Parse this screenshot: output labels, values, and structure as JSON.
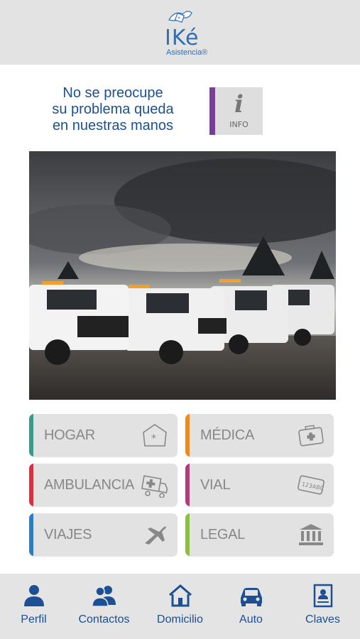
{
  "header": {
    "logo_text": "IKé",
    "logo_sub": "Asistencia®"
  },
  "tagline": {
    "line1": "No se preocupe",
    "line2": "su problema queda",
    "line3": "en nuestras manos"
  },
  "info_button": {
    "label": "INFO",
    "accent": "#7b3c97"
  },
  "services": [
    {
      "label": "HOGAR",
      "color": "#3a9a8a",
      "icon": "house-icon"
    },
    {
      "label": "MÉDICA",
      "color": "#f08a1e",
      "icon": "medical-kit-icon"
    },
    {
      "label": "AMBULANCIA",
      "color": "#d8303c",
      "icon": "ambulance-icon"
    },
    {
      "label": "VIAL",
      "color": "#b23a7d",
      "icon": "license-plate-icon"
    },
    {
      "label": "VIAJES",
      "color": "#2a7ec4",
      "icon": "airplane-icon"
    },
    {
      "label": "LEGAL",
      "color": "#8cbf3f",
      "icon": "courthouse-icon"
    }
  ],
  "nav": [
    {
      "label": "Perfil",
      "icon": "person-icon"
    },
    {
      "label": "Contactos",
      "icon": "contacts-icon"
    },
    {
      "label": "Domicilio",
      "icon": "home-icon"
    },
    {
      "label": "Auto",
      "icon": "car-icon"
    },
    {
      "label": "Claves",
      "icon": "id-card-icon"
    }
  ],
  "colors": {
    "brand_blue": "#1c4f93",
    "header_bg": "#e3e3e3"
  }
}
